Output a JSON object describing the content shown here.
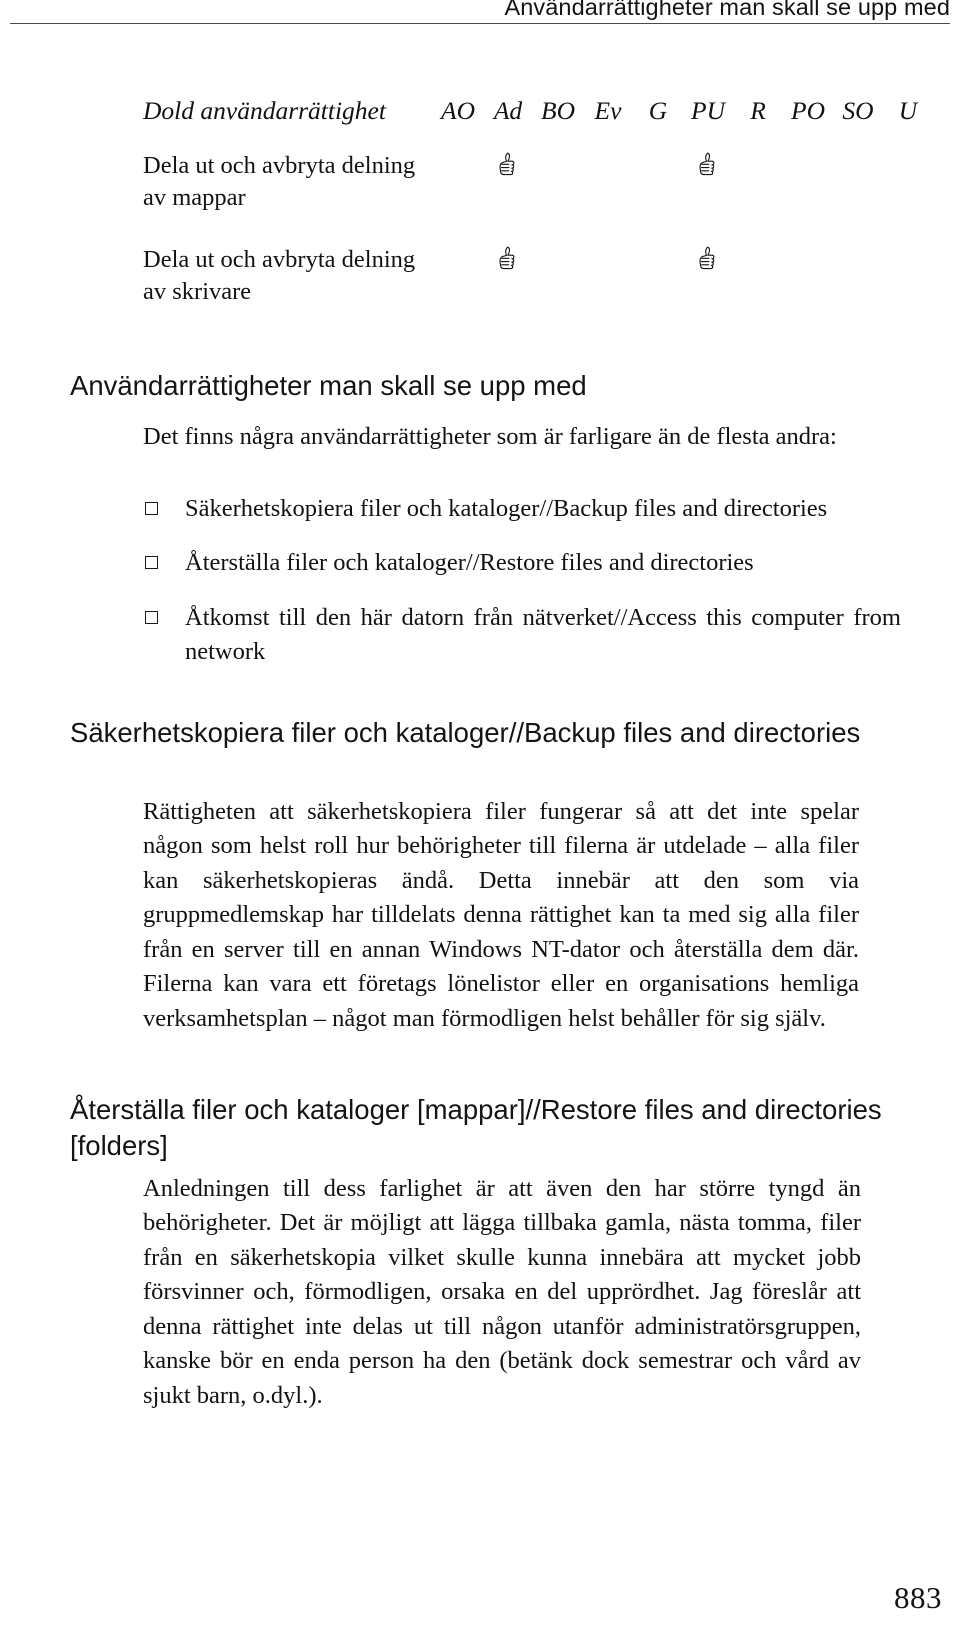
{
  "running_header": {
    "title": "Användarrättigheter man skall se upp med"
  },
  "table": {
    "row_header_label": "Dold användarrättighet",
    "columns": [
      "AO",
      "Ad",
      "BO",
      "Ev",
      "G",
      "PU",
      "R",
      "PO",
      "SO",
      "U"
    ],
    "icon_name": "thumbs-up-icon",
    "rows": [
      {
        "label": "Dela ut och avbryta delning av mappar",
        "flags": [
          "",
          "thumbs-up",
          "",
          "",
          "",
          "thumbs-up",
          "",
          "",
          "",
          ""
        ]
      },
      {
        "label": "Dela ut och avbryta delning av skrivare",
        "flags": [
          "",
          "thumbs-up",
          "",
          "",
          "",
          "thumbs-up",
          "",
          "",
          "",
          ""
        ]
      }
    ]
  },
  "sections": {
    "warnings": {
      "heading": "Användarrättigheter man skall se upp med",
      "intro": "Det finns några användarrättigheter som är farligare än de flesta andra:",
      "bullets": [
        "Säkerhetskopiera filer och kataloger//Backup files and directories",
        "Återställa filer och kataloger//Restore files and directories",
        "Åtkomst till den här datorn från nätverket//Access this computer from network"
      ]
    },
    "backup": {
      "heading": "Säkerhetskopiera filer och kataloger//Backup files and directories",
      "paragraph": "Rättigheten att säkerhetskopiera filer fungerar så att det inte spelar någon som helst roll hur behörigheter till filerna är utdelade – alla filer kan säkerhetskopieras ändå. Detta innebär att den som via gruppmedlemskap har tilldelats denna rättighet kan ta med sig alla filer från en server till en annan Windows NT-dator och återställa dem där. Filerna kan vara ett företags lönelistor eller en organisations hemliga verksamhetsplan – något man förmodligen helst behåller för sig själv."
    },
    "restore": {
      "heading": "Återställa filer och kataloger [mappar]//Restore files and directories [folders]",
      "paragraph": "Anledningen till dess farlighet är att även den har större tyngd än behörigheter. Det är möjligt att lägga tillbaka gamla, nästa tomma, filer från en säkerhetskopia vilket skulle kunna innebära att mycket jobb försvinner och, förmodligen, orsaka en del upprördhet. Jag föreslår att denna rättighet inte delas ut till någon utanför administratörsgruppen, kanske bör en enda person ha den (betänk dock semestrar och vård av sjukt barn, o.dyl.)."
    }
  },
  "folio": {
    "page_number": "883"
  }
}
